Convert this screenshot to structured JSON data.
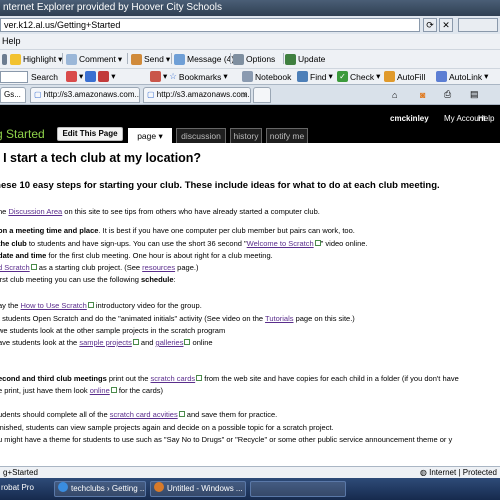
{
  "window": {
    "title": "nternet Explorer provided by Hoover City Schools",
    "address": "ver.k12.al.us/Getting+Started"
  },
  "menu": {
    "help": "Help"
  },
  "toolbar1": {
    "highlight": "Highlight",
    "comment": "Comment",
    "send": "Send",
    "message": "Message (4)",
    "options": "Options",
    "update": "Update"
  },
  "toolbar2": {
    "search": "Search",
    "bookmarks": "Bookmarks",
    "notebook": "Notebook",
    "find": "Find",
    "check": "Check",
    "autofill": "AutoFill",
    "autolink": "AutoLink"
  },
  "tabs": [
    {
      "label": "Gs..."
    },
    {
      "label": "http://s3.amazonaws.com...."
    },
    {
      "label": "http://s3.amazonaws.com...."
    }
  ],
  "site": {
    "brand": "g Started",
    "edit": "Edit This Page",
    "tab_page": "page",
    "tab_discussion": "discussion",
    "tab_history": "history",
    "tab_notify": "notify me",
    "user": "cmckinley",
    "account": "My Account",
    "help": "Help"
  },
  "content": {
    "title": "o I start a tech club at my location?",
    "subtitle": "these 10 easy steps for starting your club. These include ideas for what to do at each club meeting.",
    "l1a": "he ",
    "l1link": "Discussion Area",
    "l1b": " on this site to see tips from others who have already started a computer club.",
    "l2b": "on a meeting time and place",
    "l2c": ". It is best if you have one computer per club member but pairs can work, too.",
    "l3b": " the club",
    "l3c": " to students and have sign-ups. You can use the short 36 second \"",
    "l3link": "Welcome to Scratch",
    "l3d": "\" video online.",
    "l4b": "date and time",
    "l4c": " for the first club meeting. One hour is about right for a club meeting.",
    "l5link": "d Scratch",
    "l5b": " as a starting club project. (See ",
    "l5link2": "resources",
    "l5c": " page.)",
    "l6a": "irst club meeting you can use the following ",
    "l6b": "schedule",
    "l6c": ":",
    "l7a": "ay the ",
    "l7link": "How to Use Scratch",
    "l7b": " introductory video for the group.",
    "l8a": "t students Open Scratch and do the \"animated initials\" activity (See video on the ",
    "l8link": "Tutorials",
    "l8b": " page on this site.)",
    "l9a": "we students look at the other sample projects in the scratch program",
    "l10a": "ave students look at the ",
    "l10link": "sample projects",
    "l10b": " and ",
    "l10link2": "galleries",
    "l10c": " online",
    "l11b": "econd and third club meetings",
    "l11c": " print out the ",
    "l11link": "scratch cards",
    "l11d": " from the web site and have copies for each child in a folder (if you don't have",
    "l12a": "e print, just have them look ",
    "l12link": "online",
    "l12b": " for the cards)",
    "l13a": "udents should complete all of the ",
    "l13link": "scratch card acvities",
    "l13b": " and save them for practice.",
    "l14a": "inished, students can view sample projects again and decide on a possible topic for a scratch project.",
    "l15a": "u might have a theme for students to use such as \"Say No to Drugs\" or \"Recycle\" or some other public service announcement theme or y"
  },
  "status": {
    "left": "g+Started",
    "right": "Internet | Protected"
  },
  "taskbar": {
    "item1": "robat Pro",
    "item2": "techclubs › Getting ...",
    "item3": "Untitled - Windows ..."
  }
}
